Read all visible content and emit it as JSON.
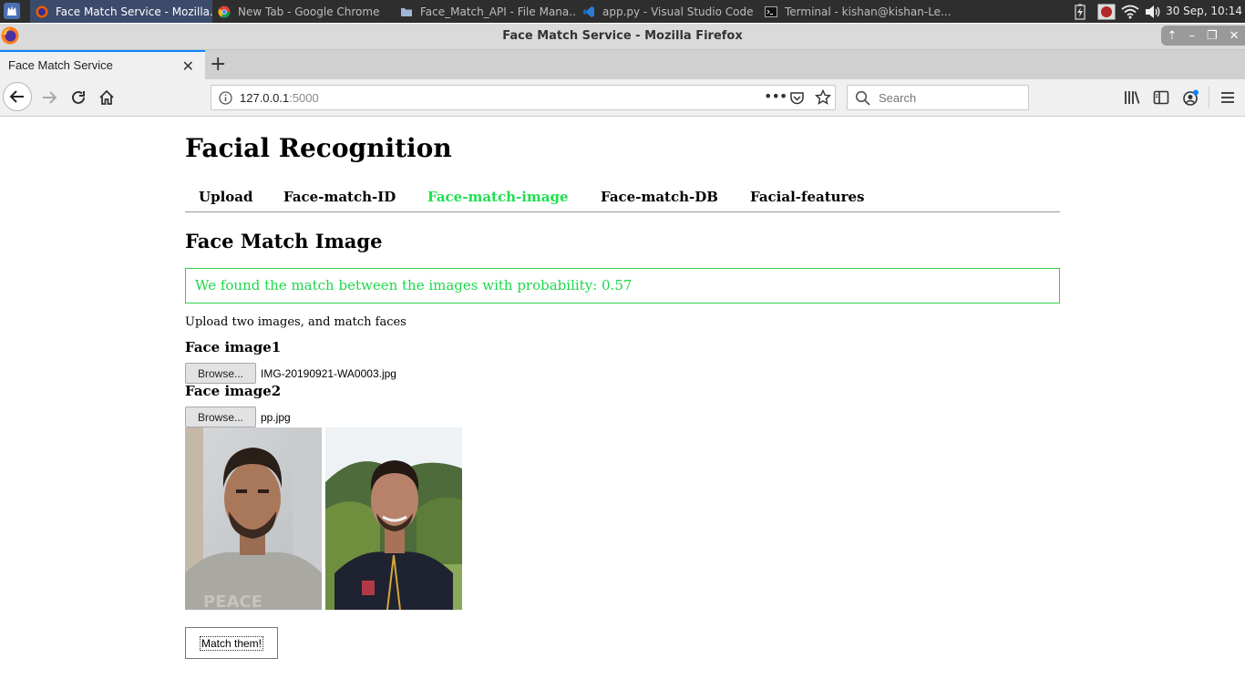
{
  "taskbar": {
    "tasks": [
      {
        "label": "Face Match Service - Mozilla..."
      },
      {
        "label": "New Tab - Google Chrome"
      },
      {
        "label": "Face_Match_API - File Mana..."
      },
      {
        "label": "app.py - Visual Studio Code"
      },
      {
        "label": "Terminal - kishan@kishan-Le..."
      }
    ],
    "clock": "30 Sep, 10:14"
  },
  "window": {
    "title": "Face Match Service - Mozilla Firefox"
  },
  "browser": {
    "tab_label": "Face Match Service",
    "url_host": "127.0.0.1",
    "url_port": ":5000",
    "search_placeholder": "Search"
  },
  "page": {
    "site_title": "Facial Recognition",
    "nav": [
      {
        "label": "Upload"
      },
      {
        "label": "Face-match-ID"
      },
      {
        "label": "Face-match-image"
      },
      {
        "label": "Face-match-DB"
      },
      {
        "label": "Facial-features"
      }
    ],
    "active_nav": "Face-match-image",
    "section_title": "Face Match Image",
    "result_message": "We found the match between the images with probability: 0.57",
    "instructions": "Upload two images, and match faces",
    "field1": {
      "label": "Face image1",
      "button": "Browse...",
      "file": "IMG-20190921-WA0003.jpg"
    },
    "field2": {
      "label": "Face image2",
      "button": "Browse...",
      "file": "pp.jpg"
    },
    "submit_label": "Match them!"
  },
  "colors": {
    "accent_green": "#1ee050",
    "tab_accent": "#0a84ff",
    "taskbar_bg": "#2e2e2e"
  }
}
